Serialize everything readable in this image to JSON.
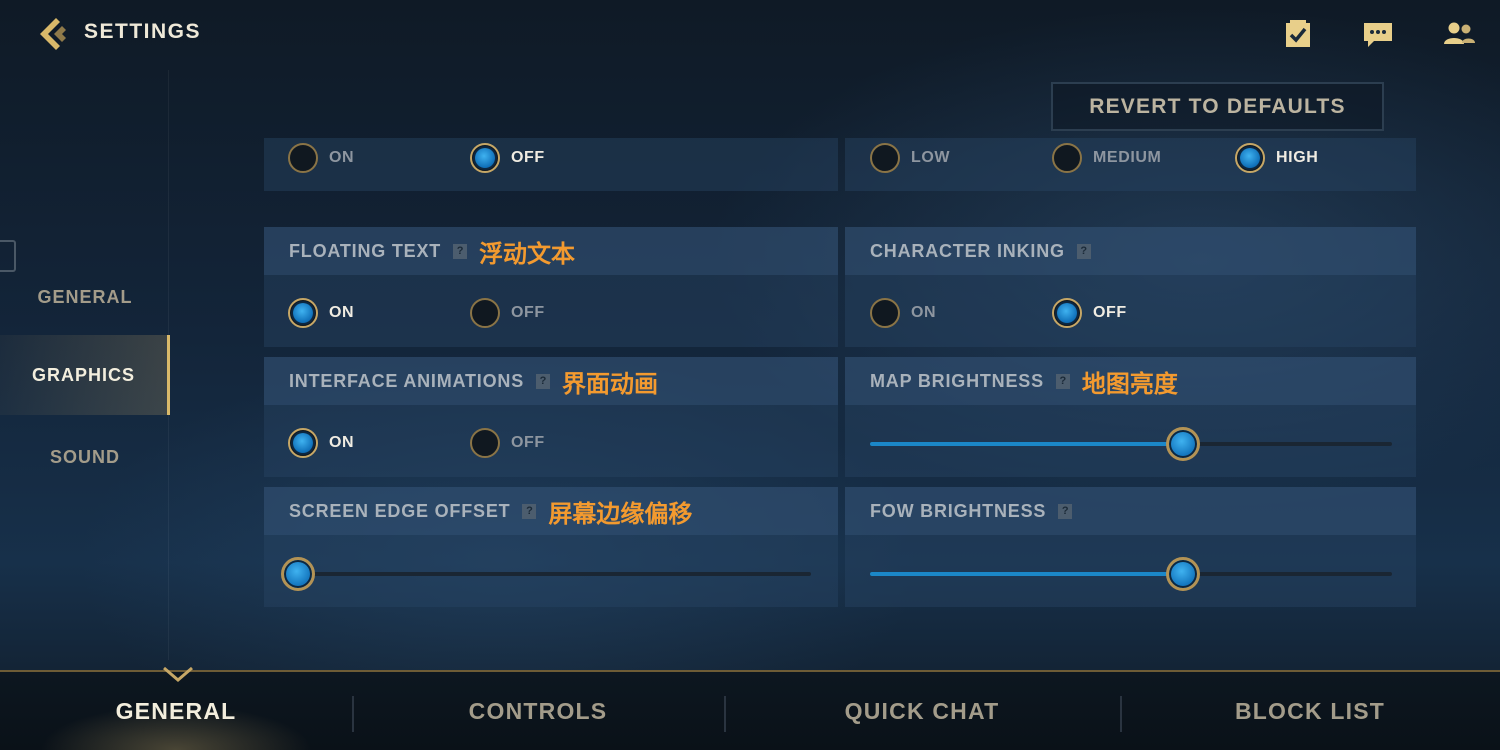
{
  "header": {
    "title": "SETTINGS",
    "icons": [
      "back-icon",
      "tasks-icon",
      "chat-icon",
      "friends-icon"
    ],
    "revert_label": "REVERT TO DEFAULTS"
  },
  "sidebar": {
    "items": [
      {
        "label": "GENERAL",
        "selected": false
      },
      {
        "label": "GRAPHICS",
        "selected": true
      },
      {
        "label": "SOUND",
        "selected": false
      }
    ]
  },
  "panels": {
    "top_left": {
      "options": [
        "ON",
        "OFF"
      ],
      "selected": "OFF"
    },
    "top_right": {
      "options": [
        "LOW",
        "MEDIUM",
        "HIGH"
      ],
      "selected": "HIGH"
    },
    "floating_text": {
      "label": "FLOATING TEXT",
      "note": "浮动文本",
      "options": [
        "ON",
        "OFF"
      ],
      "selected": "ON"
    },
    "character_inking": {
      "label": "CHARACTER INKING",
      "options": [
        "ON",
        "OFF"
      ],
      "selected": "OFF"
    },
    "interface_animations": {
      "label": "INTERFACE ANIMATIONS",
      "note": "界面动画",
      "options": [
        "ON",
        "OFF"
      ],
      "selected": "ON"
    },
    "map_brightness": {
      "label": "MAP BRIGHTNESS",
      "note": "地图亮度",
      "value_fraction": 0.6
    },
    "screen_edge_offset": {
      "label": "SCREEN EDGE OFFSET",
      "note": "屏幕边缘偏移",
      "value_fraction": 0.0
    },
    "fow_brightness": {
      "label": "FOW BRIGHTNESS",
      "value_fraction": 0.6
    }
  },
  "help_glyph": "?",
  "bottom_tabs": [
    {
      "label": "GENERAL",
      "selected": true
    },
    {
      "label": "CONTROLS",
      "selected": false
    },
    {
      "label": "QUICK CHAT",
      "selected": false
    },
    {
      "label": "BLOCK LIST",
      "selected": false
    }
  ],
  "colors": {
    "accent_gold": "#c6a766",
    "accent_blue": "#1b87c8",
    "annotation_orange": "#f39a2f"
  }
}
